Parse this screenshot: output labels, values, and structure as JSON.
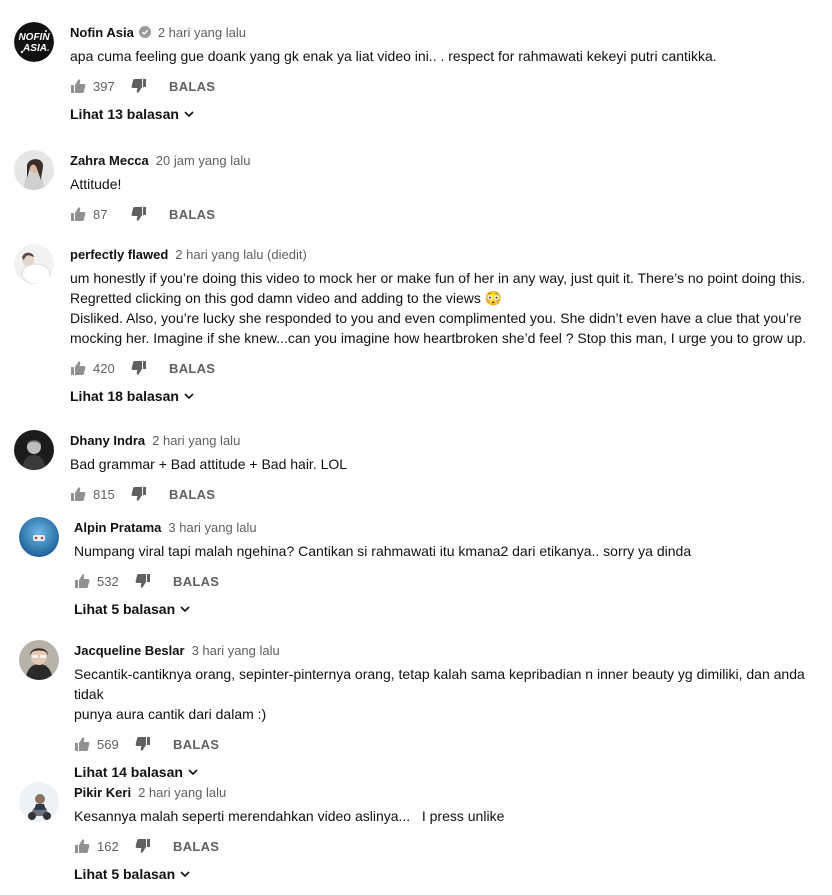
{
  "comments": [
    {
      "author": "Nofin Asia",
      "verified": true,
      "time": "2 hari yang lalu",
      "text": "apa cuma feeling gue doank yang  gk enak ya liat video ini.. . respect for rahmawati kekeyi putri cantikka.",
      "likes": "397",
      "reply_label": "BALAS",
      "replies_label": "Lihat 13 balasan",
      "avatar": "nofin-asia-logo",
      "avatar_text": "NOFIN ASIA"
    },
    {
      "author": "Zahra Mecca",
      "time": "20 jam yang lalu",
      "text": "Attitude!",
      "likes": "87",
      "reply_label": "BALAS",
      "avatar": "user-photo-woman"
    },
    {
      "author": "perfectly flawed",
      "time": "2 hari yang lalu (diedit)",
      "text_lines": [
        "um honestly if you’re doing this video to mock her or make fun of her in any way, just quit it. There’s no point doing this.",
        "Regretted clicking on this god damn video and adding to the views",
        "Disliked. Also, you’re lucky she responded to you and even complimented you. She didn’t even have a clue that you’re",
        "mocking her. Imagine if she knew...can you imagine how heartbroken she’d feel ? Stop this man, I urge you to grow up."
      ],
      "emoji": "😳",
      "likes": "420",
      "reply_label": "BALAS",
      "replies_label": "Lihat 18 balasan",
      "avatar": "user-photo-white"
    },
    {
      "author": "Dhany Indra",
      "time": "2 hari yang lalu",
      "text": "Bad grammar + Bad attitude + Bad hair. LOL",
      "likes": "815",
      "reply_label": "BALAS",
      "avatar": "user-photo-dark"
    },
    {
      "author": "Alpin Pratama",
      "time": "3 hari yang lalu",
      "text": "Numpang viral tapi malah ngehina? Cantikan si rahmawati itu kmana2 dari etikanya.. sorry ya dinda",
      "likes": "532",
      "reply_label": "BALAS",
      "replies_label": "Lihat 5 balasan",
      "avatar": "user-photo-blue"
    },
    {
      "author": "Jacqueline Beslar",
      "time": "3 hari yang lalu",
      "text_lines": [
        "Secantik-cantiknya orang, sepinter-pinternya orang, tetap kalah sama kepribadian n inner beauty yg dimiliki, dan anda tidak",
        "punya aura cantik dari dalam :)"
      ],
      "likes": "569",
      "reply_label": "BALAS",
      "replies_label": "Lihat 14 balasan",
      "avatar": "user-photo-sunglasses"
    },
    {
      "author": "Pikir Keri",
      "time": "2 hari yang lalu",
      "text": "Kesannya malah seperti merendahkan video aslinya...   I press unlike",
      "likes": "162",
      "reply_label": "BALAS",
      "replies_label": "Lihat 5 balasan",
      "avatar": "user-photo-rider"
    }
  ]
}
